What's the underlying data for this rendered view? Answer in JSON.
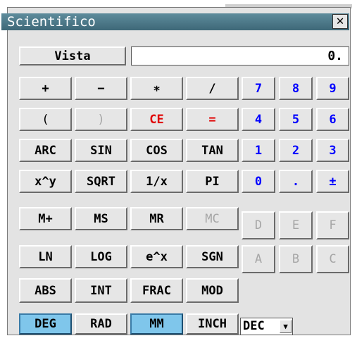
{
  "window": {
    "title": "Scientifico",
    "close_label": "✕"
  },
  "display": {
    "value": "0."
  },
  "vista_label": "Vista",
  "ops": [
    "+",
    "−",
    "∗",
    "/"
  ],
  "row2": [
    "(",
    ")",
    "CE",
    "="
  ],
  "row3": [
    "ARC",
    "SIN",
    "COS",
    "TAN"
  ],
  "row4": [
    "x^y",
    "SQRT",
    "1/x",
    "PI"
  ],
  "row5": [
    "M+",
    "MS",
    "MR",
    "MC"
  ],
  "row6": [
    "LN",
    "LOG",
    "e^x",
    "SGN"
  ],
  "row7": [
    "ABS",
    "INT",
    "FRAC",
    "MOD"
  ],
  "row8": [
    "DEG",
    "RAD",
    "MM",
    "INCH"
  ],
  "digits": {
    "r1": [
      "7",
      "8",
      "9"
    ],
    "r2": [
      "4",
      "5",
      "6"
    ],
    "r3": [
      "1",
      "2",
      "3"
    ],
    "r4": [
      "0",
      ".",
      "±"
    ],
    "r5": [
      "D",
      "E",
      "F"
    ],
    "r6": [
      "A",
      "B",
      "C"
    ]
  },
  "base_select": {
    "value": "DEC",
    "arrow_icon": "chevron-down-icon"
  },
  "colors": {
    "title_bar": "#4a7a8a",
    "selected": "#7fc6eb",
    "digit_blue": "#0000ff",
    "accent_red": "#e00000"
  }
}
